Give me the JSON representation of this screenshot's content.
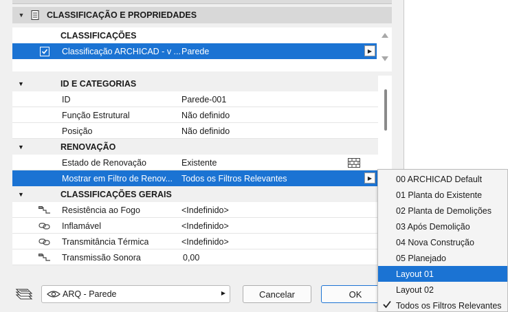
{
  "section": {
    "title": "CLASSIFICAÇÃO E PROPRIEDADES",
    "toggle_icon": "triangle-down-icon",
    "icon": "document-icon"
  },
  "classifications": {
    "header": "CLASSIFICAÇÕES",
    "row": {
      "checked": true,
      "name": "Classificação ARCHICAD - v ...",
      "value": "Parede"
    }
  },
  "properties": {
    "groups": [
      {
        "title": "ID E CATEGORIAS",
        "rows": [
          {
            "label": "ID",
            "value": "Parede-001"
          },
          {
            "label": "Função Estrutural",
            "value": "Não definido"
          },
          {
            "label": "Posição",
            "value": "Não definido"
          }
        ]
      },
      {
        "title": "RENOVAÇÃO",
        "rows": [
          {
            "label": "Estado de Renovação",
            "value": "Existente",
            "icon": "brick-wall-icon"
          },
          {
            "label": "Mostrar em Filtro de Renov...",
            "value": "Todos os Filtros Relevantes",
            "selected": true
          }
        ]
      },
      {
        "title": "CLASSIFICAÇÕES GERAIS",
        "rows": [
          {
            "label": "Resistência ao Fogo",
            "value": "<Indefinido>",
            "icon": "link-icon"
          },
          {
            "label": "Inflamável",
            "value": "<Indefinido>",
            "icon": "chain-link-icon"
          },
          {
            "label": "Transmitância Térmica",
            "value": "<Indefinido>",
            "icon": "chain-link-icon"
          },
          {
            "label": "Transmissão Sonora",
            "value": "0,00",
            "icon": "link-icon"
          }
        ]
      }
    ]
  },
  "footer": {
    "layer_icon": "layers-icon",
    "layer_visibility_icon": "eye-icon",
    "layer_name": "ARQ - Parede",
    "cancel_label": "Cancelar",
    "ok_label": "OK"
  },
  "renovation_filter_menu": {
    "items": [
      {
        "label": "00 ARCHICAD Default"
      },
      {
        "label": "01 Planta do Existente"
      },
      {
        "label": "02 Planta de Demolições"
      },
      {
        "label": "03 Após Demolição"
      },
      {
        "label": "04 Nova Construção"
      },
      {
        "label": "05 Planejado"
      },
      {
        "label": "Layout 01",
        "highlighted": true
      },
      {
        "label": "Layout 02"
      },
      {
        "label": "Todos os Filtros Relevantes",
        "checked": true
      }
    ]
  },
  "colors": {
    "selection": "#1b73d3",
    "group_row": "#f0f0f0",
    "dialog_bg": "#f0f0f0"
  }
}
